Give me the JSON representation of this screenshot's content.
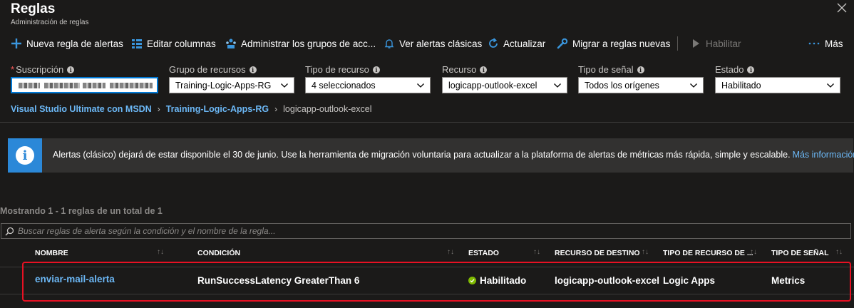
{
  "header": {
    "title": "Reglas",
    "subtitle": "Administración de reglas"
  },
  "toolbar": {
    "new_rule": "Nueva regla de alertas",
    "edit_columns": "Editar columnas",
    "manage_groups": "Administrar los grupos de acc...",
    "classic_alerts": "Ver alertas clásicas",
    "refresh": "Actualizar",
    "migrate": "Migrar a reglas nuevas",
    "enable": "Habilitar",
    "more": "Más"
  },
  "filters": {
    "subscription": {
      "label": "Suscripción",
      "required": "*"
    },
    "resource_group": {
      "label": "Grupo de recursos",
      "value": "Training-Logic-Apps-RG"
    },
    "resource_type": {
      "label": "Tipo de recurso",
      "value": "4 seleccionados"
    },
    "resource": {
      "label": "Recurso",
      "value": "logicapp-outlook-excel"
    },
    "signal_type": {
      "label": "Tipo de señal",
      "value": "Todos los orígenes"
    },
    "state": {
      "label": "Estado",
      "value": "Habilitado"
    }
  },
  "breadcrumb": {
    "items": [
      "Visual Studio Ultimate con MSDN",
      "Training-Logic-Apps-RG"
    ],
    "current": "logicapp-outlook-excel"
  },
  "banner": {
    "text": "Alertas (clásico) dejará de estar disponible el 30 de junio. Use la herramienta de migración voluntaria para actualizar a la plataforma de alertas de métricas más rápida, simple y escalable.",
    "link": "Más información"
  },
  "results": {
    "count_text": "Mostrando 1 - 1 reglas de un total de 1",
    "search_placeholder": "Buscar reglas de alerta según la condición y el nombre de la regla..."
  },
  "table": {
    "columns": [
      "NOMBRE",
      "CONDICIÓN",
      "ESTADO",
      "RECURSO DE DESTINO",
      "TIPO DE RECURSO DE ...",
      "TIPO DE SEÑAL"
    ],
    "rows": [
      {
        "name": "enviar-mail-alerta",
        "condition": "RunSuccessLatency GreaterThan 6",
        "state": "Habilitado",
        "target": "logicapp-outlook-excel",
        "resource_type": "Logic Apps",
        "signal_type": "Metrics"
      }
    ]
  },
  "colors": {
    "background": "#1b1a19",
    "accent": "#0078d4",
    "link": "#6cb8f6",
    "success": "#7fba00",
    "highlight": "#e81123"
  }
}
